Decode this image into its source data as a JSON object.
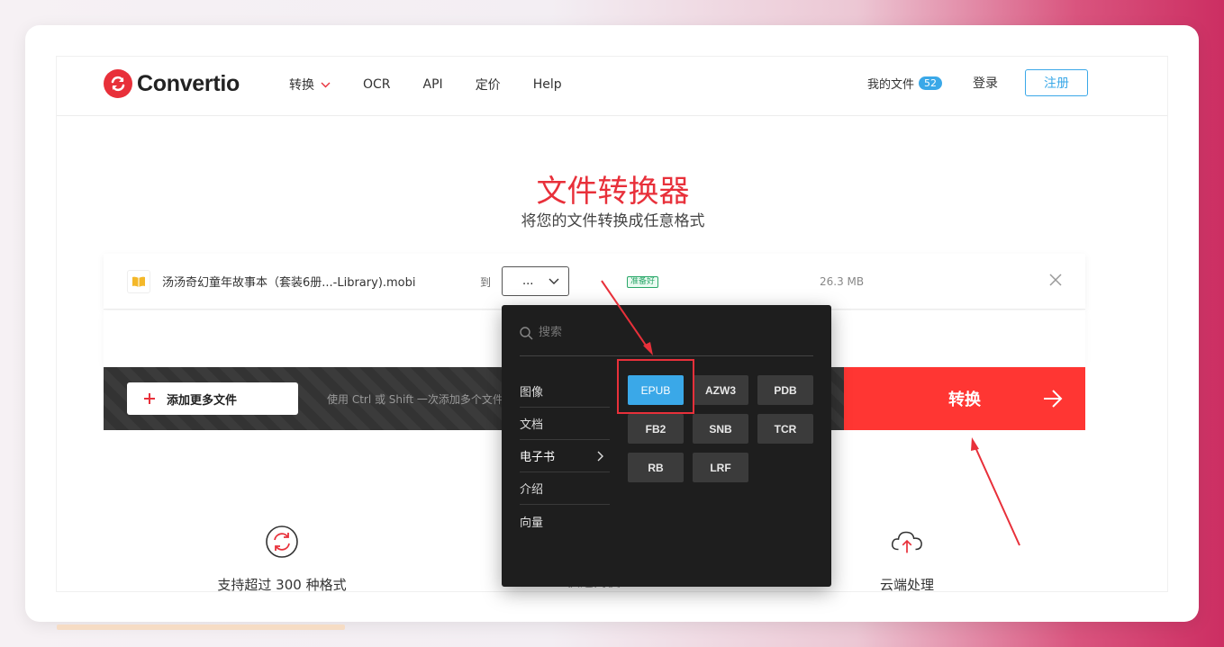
{
  "brand": {
    "name": "Convertio",
    "accent": "#e8303a",
    "link_color": "#3aa8e8"
  },
  "header": {
    "nav": [
      {
        "label": "转换",
        "has_dropdown": true
      },
      {
        "label": "OCR"
      },
      {
        "label": "API"
      },
      {
        "label": "定价"
      },
      {
        "label": "Help"
      }
    ],
    "my_files_label": "我的文件",
    "my_files_count": "52",
    "login_label": "登录",
    "signup_label": "注册"
  },
  "hero": {
    "title": "文件转换器",
    "subtitle": "将您的文件转换成任意格式"
  },
  "file": {
    "icon": "book-icon",
    "name": "汤汤奇幻童年故事本（套装6册...-Library).mobi",
    "to_label": "到",
    "selected_format": "...",
    "status": "准备好",
    "size": "26.3 MB"
  },
  "actions": {
    "add_files_label": "添加更多文件",
    "hint": "使用 Ctrl 或 Shift 一次添加多个文件",
    "convert_label": "转换"
  },
  "features": [
    {
      "icon": "refresh-circle-icon",
      "label": "支持超过 300 种格式"
    },
    {
      "icon": "speed-icon",
      "label": "快速简便"
    },
    {
      "icon": "cloud-upload-icon",
      "label": "云端处理"
    }
  ],
  "dropdown": {
    "search_placeholder": "搜索",
    "categories": [
      "图像",
      "文档",
      "电子书",
      "介绍",
      "向量"
    ],
    "active_category": "电子书",
    "formats": [
      "EPUB",
      "AZW3",
      "PDB",
      "FB2",
      "SNB",
      "TCR",
      "RB",
      "LRF"
    ],
    "selected_format": "EPUB"
  }
}
